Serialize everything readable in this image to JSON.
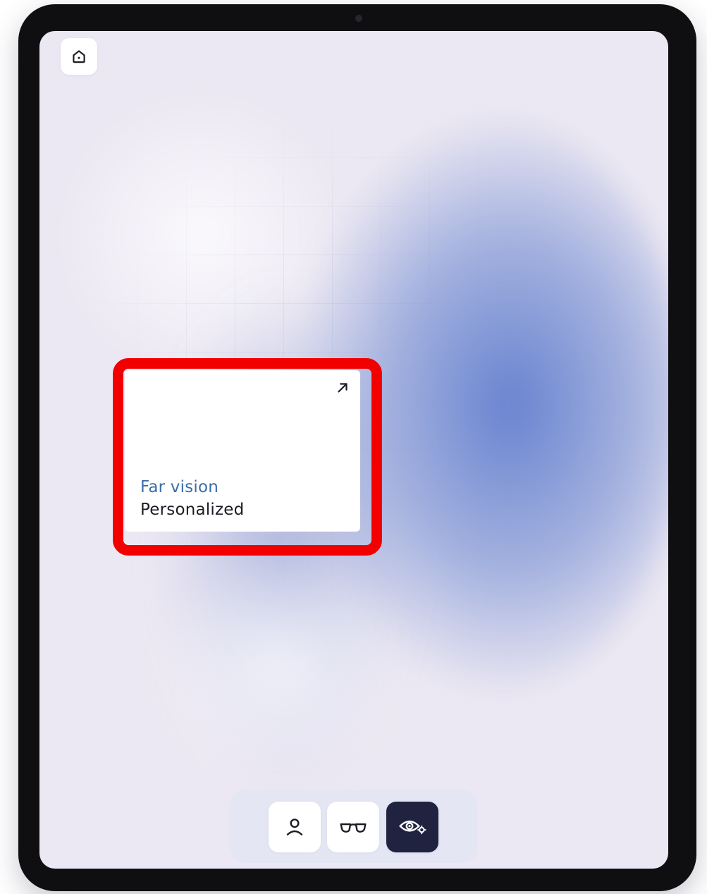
{
  "card": {
    "title": "Far vision",
    "subtitle": "Personalized",
    "title_color": "#3a6ea6",
    "highlight_color": "#f20000",
    "corner_icon": "arrow-up-right-icon"
  },
  "toolbar": {
    "home_icon": "home-icon"
  },
  "dock": {
    "items": [
      {
        "icon": "user-icon",
        "active": false
      },
      {
        "icon": "glasses-icon",
        "active": false
      },
      {
        "icon": "eye-settings-icon",
        "active": true
      }
    ],
    "active_color": "#1f2340"
  }
}
